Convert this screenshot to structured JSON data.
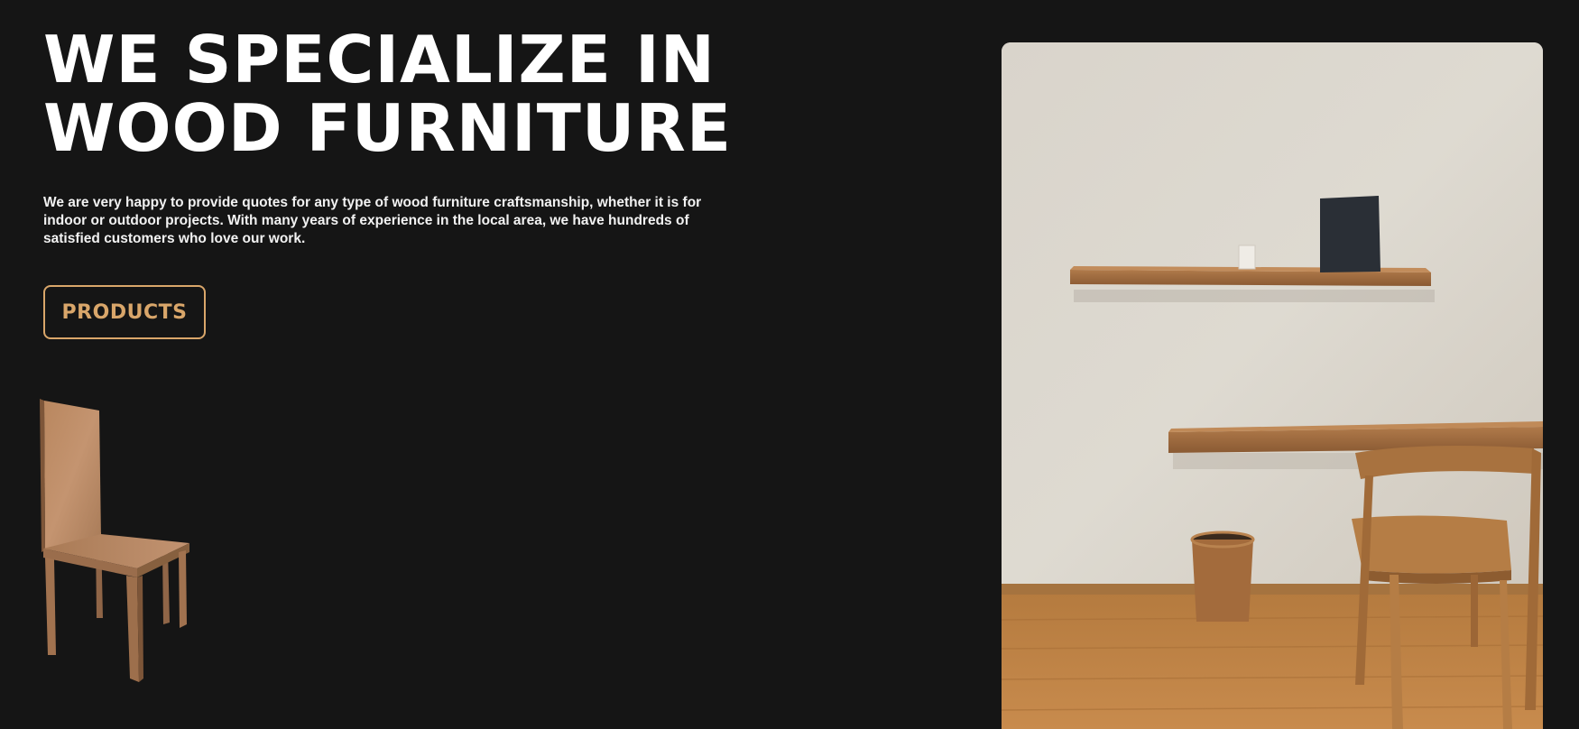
{
  "hero": {
    "title": "WE SPECIALIZE IN WOOD FURNITURE",
    "description": "We are very happy to provide quotes for any type of wood furniture craftsmanship, whether it is for indoor or outdoor projects. With many years of experience in the local area, we have hundreds of satisfied customers who love our work.",
    "cta_label": "PRODUCTS"
  },
  "colors": {
    "background": "#151515",
    "accent": "#d9a66a",
    "text": "#ffffff"
  },
  "images": {
    "chair_model": "wooden-chair-3d-render",
    "room_photo": "wooden-desk-shelf-chair-room-photo"
  }
}
